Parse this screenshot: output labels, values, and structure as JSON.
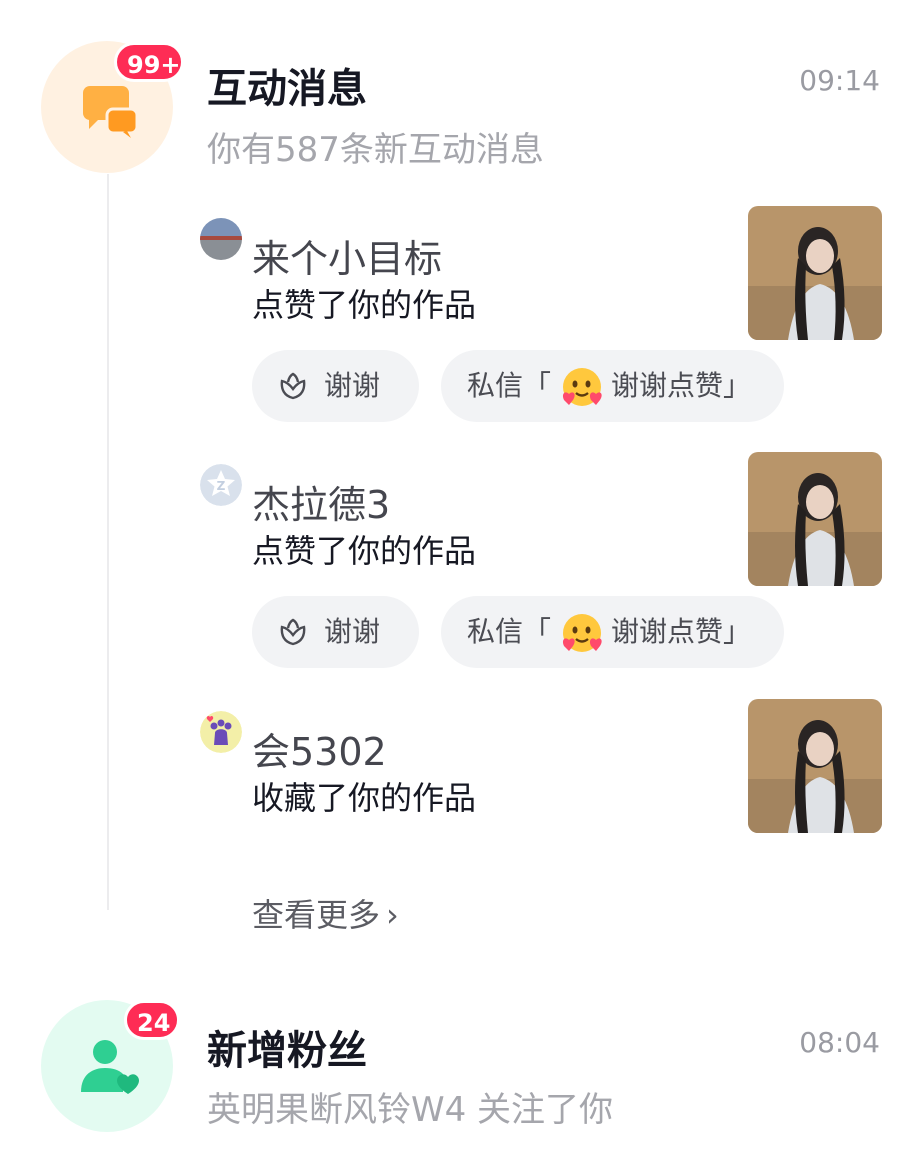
{
  "interaction": {
    "title": "互动消息",
    "time": "09:14",
    "subtitle": "你有587条新互动消息",
    "badge": "99+",
    "icon": "chat-bubbles-icon",
    "accent": "#ffad3b"
  },
  "items": [
    {
      "username": "来个小目标",
      "action": "点赞了你的作品",
      "avatar": "landscape-avatar",
      "actions": {
        "thanks": "谢谢",
        "dm_prefix": "私信「",
        "dm_text": "谢谢点赞」"
      }
    },
    {
      "username": "杰拉德3",
      "action": "点赞了你的作品",
      "avatar": "default-avatar",
      "actions": {
        "thanks": "谢谢",
        "dm_prefix": "私信「",
        "dm_text": "谢谢点赞」"
      }
    },
    {
      "username": "会5302",
      "action": "收藏了你的作品",
      "avatar": "paw-avatar"
    }
  ],
  "more_label": "查看更多",
  "fans": {
    "title": "新增粉丝",
    "time": "08:04",
    "subtitle": "英明果断风铃W4 关注了你",
    "badge": "24",
    "icon": "user-heart-icon",
    "accent": "#2fcf92"
  },
  "colors": {
    "badge": "#fe2c55",
    "pill_bg": "#f2f3f5"
  }
}
